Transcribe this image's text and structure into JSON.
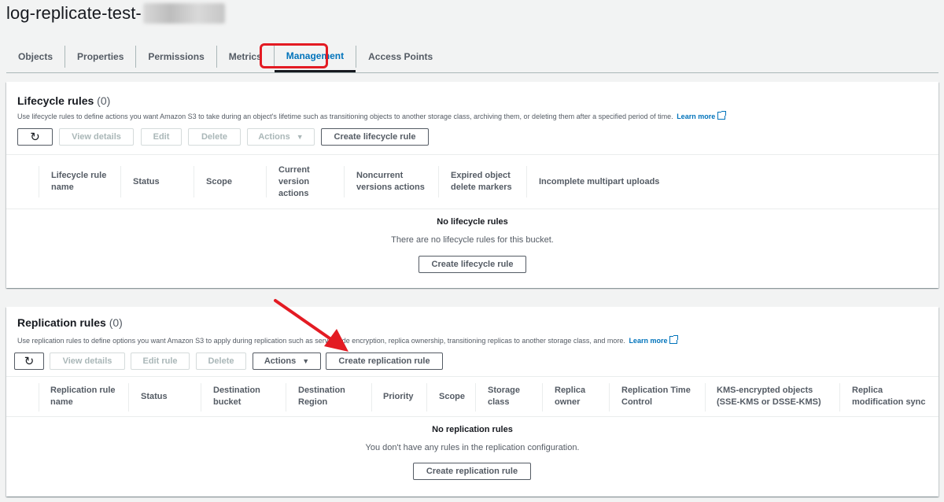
{
  "bucket": {
    "title": "log-replicate-test-"
  },
  "tabs": [
    {
      "label": "Objects"
    },
    {
      "label": "Properties"
    },
    {
      "label": "Permissions"
    },
    {
      "label": "Metrics"
    },
    {
      "label": "Management"
    },
    {
      "label": "Access Points"
    }
  ],
  "lifecycle": {
    "title": "Lifecycle rules",
    "count": "(0)",
    "description": "Use lifecycle rules to define actions you want Amazon S3 to take during an object's lifetime such as transitioning objects to another storage class, archiving them, or deleting them after a specified period of time.",
    "learn_more": "Learn more",
    "buttons": {
      "refresh": "↻",
      "view_details": "View details",
      "edit": "Edit",
      "delete": "Delete",
      "actions": "Actions",
      "create": "Create lifecycle rule"
    },
    "columns": [
      "Lifecycle rule name",
      "Status",
      "Scope",
      "Current version actions",
      "Noncurrent versions actions",
      "Expired object delete markers",
      "Incomplete multipart uploads"
    ],
    "empty_title": "No lifecycle rules",
    "empty_sub": "There are no lifecycle rules for this bucket.",
    "empty_button": "Create lifecycle rule"
  },
  "replication": {
    "title": "Replication rules",
    "count": "(0)",
    "description": "Use replication rules to define options you want Amazon S3 to apply during replication such as server-side encryption, replica ownership, transitioning replicas to another storage class, and more.",
    "learn_more": "Learn more",
    "buttons": {
      "refresh": "↻",
      "view_details": "View details",
      "edit": "Edit rule",
      "delete": "Delete",
      "actions": "Actions",
      "create": "Create replication rule"
    },
    "columns": [
      "Replication rule name",
      "Status",
      "Destination bucket",
      "Destination Region",
      "Priority",
      "Scope",
      "Storage class",
      "Replica owner",
      "Replication Time Control",
      "KMS-encrypted objects (SSE-KMS or DSSE-KMS)",
      "Replica modification sync"
    ],
    "empty_title": "No replication rules",
    "empty_sub": "You don't have any rules in the replication configuration.",
    "empty_button": "Create replication rule"
  },
  "icons": {
    "refresh": "refresh-icon",
    "caret": "caret-down-icon",
    "external": "external-link-icon",
    "annotation": "red-arrow-icon"
  },
  "colors": {
    "accent": "#0073bb",
    "highlight": "#e31b23",
    "text": "#16191f",
    "muted": "#545b64"
  }
}
